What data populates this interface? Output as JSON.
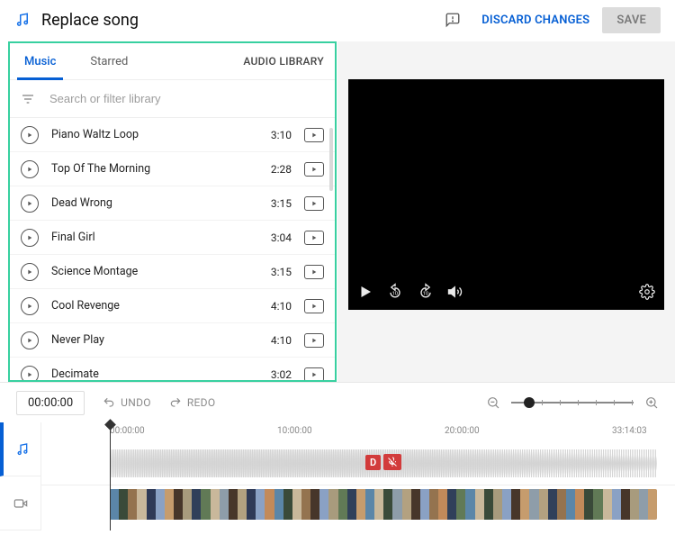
{
  "header": {
    "title": "Replace song",
    "discard_label": "DISCARD CHANGES",
    "save_label": "SAVE"
  },
  "library": {
    "tabs": {
      "music": "Music",
      "starred": "Starred"
    },
    "audio_library_link": "AUDIO LIBRARY",
    "search_placeholder": "Search or filter library",
    "tracks": [
      {
        "title": "Piano Waltz Loop",
        "duration": "3:10"
      },
      {
        "title": "Top Of The Morning",
        "duration": "2:28"
      },
      {
        "title": "Dead Wrong",
        "duration": "3:15"
      },
      {
        "title": "Final Girl",
        "duration": "3:04"
      },
      {
        "title": "Science Montage",
        "duration": "3:15"
      },
      {
        "title": "Cool Revenge",
        "duration": "4:10"
      },
      {
        "title": "Never Play",
        "duration": "4:10"
      },
      {
        "title": "Decimate",
        "duration": "3:02"
      }
    ]
  },
  "timeline": {
    "current_time": "00:00:00",
    "undo_label": "UNDO",
    "redo_label": "REDO",
    "ruler_marks": [
      "00:00:00",
      "10:00:00",
      "20:00:00",
      "33:14:03"
    ],
    "marker_letter": "D"
  },
  "thumb_colors": [
    "#5b86a8",
    "#3a4a39",
    "#94734f",
    "#c9b89b",
    "#2f3a57",
    "#8aa1c4",
    "#c69c6d",
    "#47362a",
    "#a89b7d",
    "#30405a",
    "#617a56",
    "#c9b89b",
    "#8e9da9",
    "#47362a",
    "#b3a180",
    "#2f3a57",
    "#8aa1c4",
    "#c28a5a",
    "#5b86a8",
    "#3a4a39",
    "#c9b89b",
    "#94734f",
    "#47362a",
    "#8aa1c4",
    "#a89b7d",
    "#617a56",
    "#30405a",
    "#c69c6d",
    "#5b86a8",
    "#c9b89b",
    "#3a4a39",
    "#8e9da9",
    "#b3a180",
    "#47362a",
    "#8aa1c4",
    "#94734f",
    "#c28a5a",
    "#30405a",
    "#617a56",
    "#5b86a8",
    "#c9b89b",
    "#3a4a39",
    "#a89b7d",
    "#8aa1c4",
    "#47362a",
    "#c69c6d",
    "#8e9da9",
    "#b3a180",
    "#30405a",
    "#94734f",
    "#5b86a8",
    "#c28a5a",
    "#3a4a39",
    "#617a56",
    "#c9b89b",
    "#8aa1c4",
    "#47362a",
    "#a89b7d",
    "#8e9da9",
    "#c69c6d"
  ]
}
